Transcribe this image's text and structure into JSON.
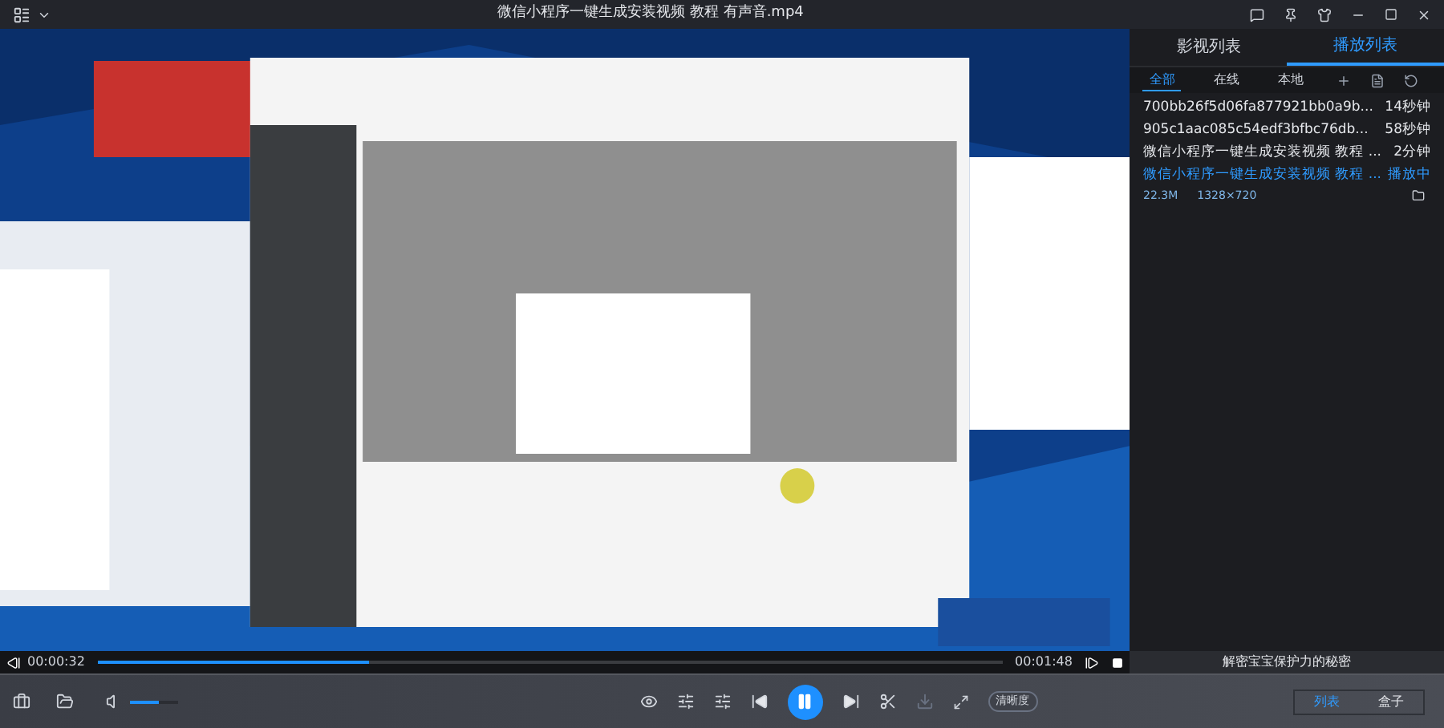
{
  "window": {
    "title": "微信小程序一键生成安装视频 教程 有声音.mp4"
  },
  "seek": {
    "elapsed": "00:00:32",
    "total": "00:01:48",
    "level": 0.3
  },
  "panel": {
    "tabs": [
      {
        "label": "影视列表",
        "selected": false
      },
      {
        "label": "播放列表",
        "selected": true
      }
    ],
    "filters": [
      {
        "label": "全部",
        "selected": true
      },
      {
        "label": "在线",
        "selected": false
      },
      {
        "label": "本地",
        "selected": false
      }
    ],
    "items": [
      {
        "name": "700bb26f5d06fa877921bb0a9b...",
        "duration": "14秒钟",
        "selected": false
      },
      {
        "name": "905c1aac085c54edf3bfbc76db...",
        "duration": "58秒钟",
        "selected": false
      },
      {
        "name": "微信小程序一键生成安装视频 教程 ...",
        "duration": "2分钟",
        "selected": false
      },
      {
        "name": "微信小程序一键生成安装视频 教程 ...",
        "duration": "播放中",
        "selected": true,
        "size": "22.3M",
        "resolution": "1328×720"
      }
    ],
    "ad": "解密宝宝保护力的秘密"
  },
  "controls": {
    "volume": {
      "level": 0.6
    },
    "quality": "清晰度",
    "paused": false,
    "buttons": [
      {
        "label": "列表",
        "selected": true
      },
      {
        "label": "盒子",
        "selected": false
      }
    ]
  }
}
